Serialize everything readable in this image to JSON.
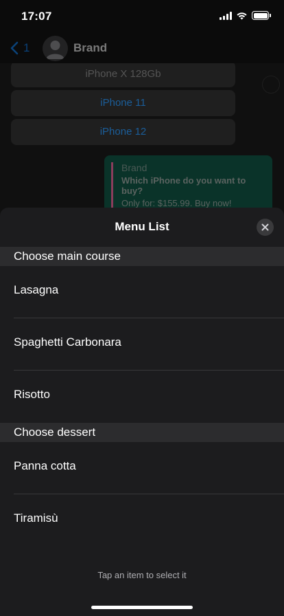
{
  "status_bar": {
    "time": "17:07"
  },
  "chat_header": {
    "back_count": "1",
    "contact_name": "Brand"
  },
  "chat": {
    "buttons": [
      "iPhone X 128Gb",
      "iPhone 11",
      "iPhone 12"
    ],
    "bubble": {
      "brand": "Brand",
      "question": "Which iPhone do you want to buy?",
      "offer": "Only for: $155.99. Buy now!"
    }
  },
  "sheet": {
    "title": "Menu List",
    "sections": [
      {
        "header": "Choose main course",
        "items": [
          "Lasagna",
          "Spaghetti Carbonara",
          "Risotto"
        ]
      },
      {
        "header": "Choose dessert",
        "items": [
          "Panna cotta",
          "Tiramisù"
        ]
      }
    ],
    "footer": "Tap an item to select it"
  },
  "colors": {
    "accent": "#0a84ff",
    "sheet_bg": "#1c1c1e",
    "section_bg": "#2c2c2e",
    "bubble_bg": "#0a3329"
  },
  "icons": {
    "back": "chevron-left-icon",
    "avatar": "person-icon",
    "close": "close-icon",
    "wifi": "wifi-icon",
    "signal": "signal-icon",
    "battery": "battery-icon"
  }
}
